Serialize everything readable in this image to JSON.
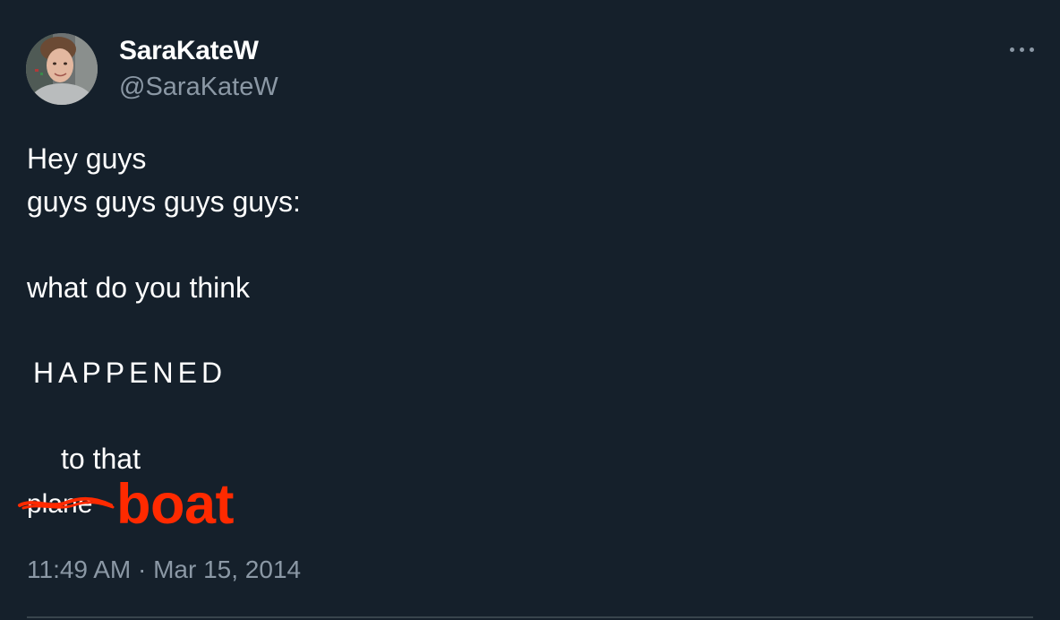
{
  "tweet": {
    "author": {
      "display_name": "SaraKateW",
      "handle": "@SaraKateW",
      "avatar_icon": "profile-photo"
    },
    "more_icon": "more-horizontal-icon",
    "lines": [
      "Hey guys",
      "guys guys guys guys:",
      "what do you think",
      "HAPPENED",
      "to that"
    ],
    "struck_word": "plane",
    "replacement_word": "boat",
    "timestamp": "11:49 AM · Mar 15, 2014"
  },
  "colors": {
    "background": "#15202b",
    "text": "#ffffff",
    "secondary_text": "#8b98a5",
    "highlight": "#ff2a00",
    "divider": "#38444d"
  }
}
